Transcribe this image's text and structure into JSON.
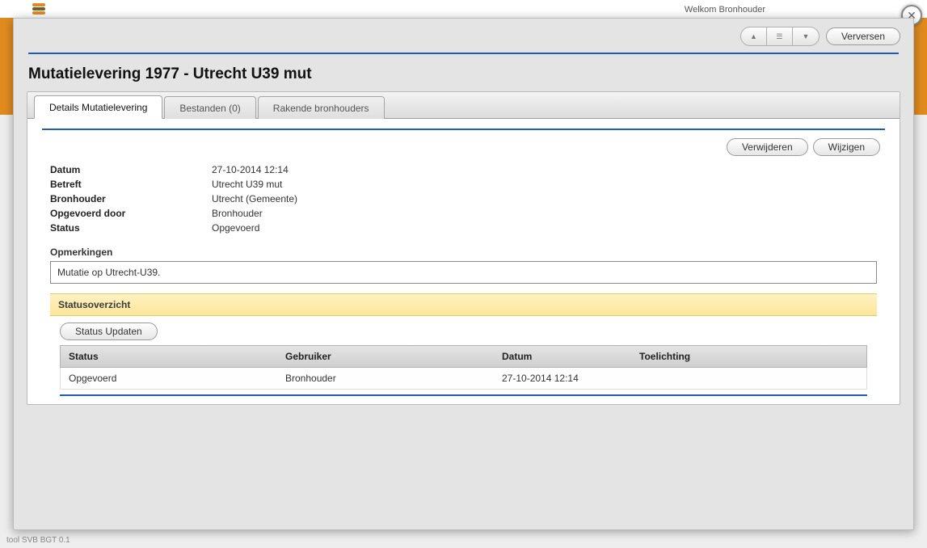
{
  "header": {
    "welcome": "Welkom Bronhouder",
    "footer": "tool SVB BGT 0.1"
  },
  "toolbar": {
    "refresh": "Verversen"
  },
  "page": {
    "title": "Mutatielevering 1977 - Utrecht U39 mut"
  },
  "tabs": {
    "details": "Details Mutatielevering",
    "files": "Bestanden (0)",
    "touching": "Rakende bronhouders"
  },
  "actions": {
    "delete": "Verwijderen",
    "edit": "Wijzigen",
    "update_status": "Status Updaten"
  },
  "details": {
    "labels": {
      "date": "Datum",
      "concerns": "Betreft",
      "holder": "Bronhouder",
      "entered_by": "Opgevoerd door",
      "status": "Status",
      "remarks": "Opmerkingen"
    },
    "values": {
      "date": "27-10-2014 12:14",
      "concerns": "Utrecht U39 mut",
      "holder": "Utrecht (Gemeente)",
      "entered_by": "Bronhouder",
      "status": "Opgevoerd"
    },
    "remarks_text": "Mutatie op Utrecht-U39."
  },
  "status_overview": {
    "heading": "Statusoverzicht",
    "columns": {
      "status": "Status",
      "user": "Gebruiker",
      "date": "Datum",
      "note": "Toelichting"
    },
    "rows": [
      {
        "status": "Opgevoerd",
        "user": "Bronhouder",
        "date": "27-10-2014 12:14",
        "note": ""
      }
    ]
  }
}
